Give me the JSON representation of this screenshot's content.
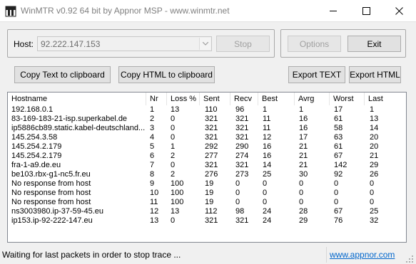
{
  "window": {
    "title": "WinMTR v0.92 64 bit by Appnor MSP - www.winmtr.net"
  },
  "host": {
    "label": "Host:",
    "value": "92.222.147.153"
  },
  "buttons": {
    "stop": "Stop",
    "options": "Options",
    "exit": "Exit",
    "copy_text": "Copy Text to clipboard",
    "copy_html": "Copy HTML to clipboard",
    "export_text": "Export TEXT",
    "export_html": "Export HTML"
  },
  "table": {
    "columns": [
      "Hostname",
      "Nr",
      "Loss %",
      "Sent",
      "Recv",
      "Best",
      "Avrg",
      "Worst",
      "Last"
    ],
    "rows": [
      [
        "192.168.0.1",
        "1",
        "13",
        "110",
        "96",
        "1",
        "1",
        "17",
        "1"
      ],
      [
        "83-169-183-21-isp.superkabel.de",
        "2",
        "0",
        "321",
        "321",
        "11",
        "16",
        "61",
        "13"
      ],
      [
        "ip5886cb89.static.kabel-deutschland...",
        "3",
        "0",
        "321",
        "321",
        "11",
        "16",
        "58",
        "14"
      ],
      [
        "145.254.3.58",
        "4",
        "0",
        "321",
        "321",
        "12",
        "17",
        "63",
        "20"
      ],
      [
        "145.254.2.179",
        "5",
        "1",
        "292",
        "290",
        "16",
        "21",
        "61",
        "20"
      ],
      [
        "145.254.2.179",
        "6",
        "2",
        "277",
        "274",
        "16",
        "21",
        "67",
        "21"
      ],
      [
        "fra-1-a9.de.eu",
        "7",
        "0",
        "321",
        "321",
        "14",
        "21",
        "142",
        "29"
      ],
      [
        "be103.rbx-g1-nc5.fr.eu",
        "8",
        "2",
        "276",
        "273",
        "25",
        "30",
        "92",
        "26"
      ],
      [
        "No response from host",
        "9",
        "100",
        "19",
        "0",
        "0",
        "0",
        "0",
        "0"
      ],
      [
        "No response from host",
        "10",
        "100",
        "19",
        "0",
        "0",
        "0",
        "0",
        "0"
      ],
      [
        "No response from host",
        "11",
        "100",
        "19",
        "0",
        "0",
        "0",
        "0",
        "0"
      ],
      [
        "ns3003980.ip-37-59-45.eu",
        "12",
        "13",
        "112",
        "98",
        "24",
        "28",
        "67",
        "25"
      ],
      [
        "ip153.ip-92-222-147.eu",
        "13",
        "0",
        "321",
        "321",
        "24",
        "29",
        "76",
        "32"
      ]
    ]
  },
  "status": {
    "text": "Waiting for last packets in order to stop trace ...",
    "link": "www.appnor.com"
  }
}
